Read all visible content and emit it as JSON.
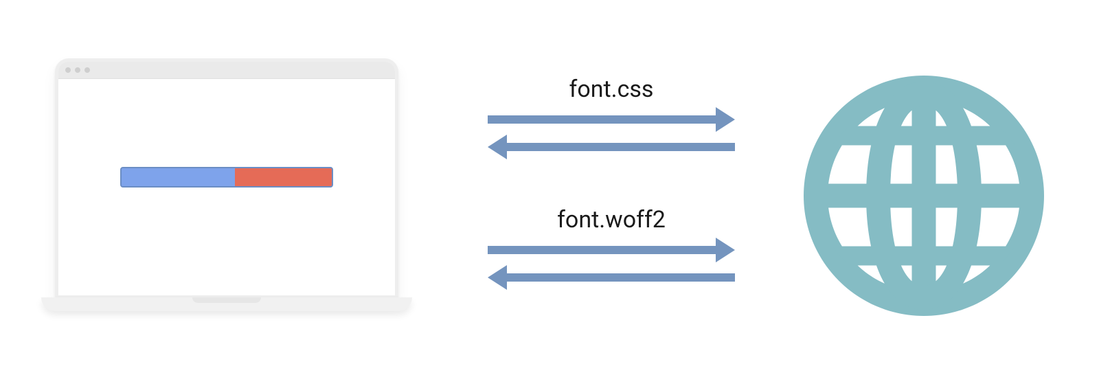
{
  "labels": {
    "request1": "font.css",
    "request2": "font.woff2"
  },
  "colors": {
    "arrow": "#7494be",
    "globe": "#85bcc4",
    "progress_track": "#7ea3eb",
    "progress_fill": "#e56b57",
    "progress_border": "#6b8dc4"
  },
  "progress": {
    "fill_side": "right",
    "fill_percent": 46
  }
}
